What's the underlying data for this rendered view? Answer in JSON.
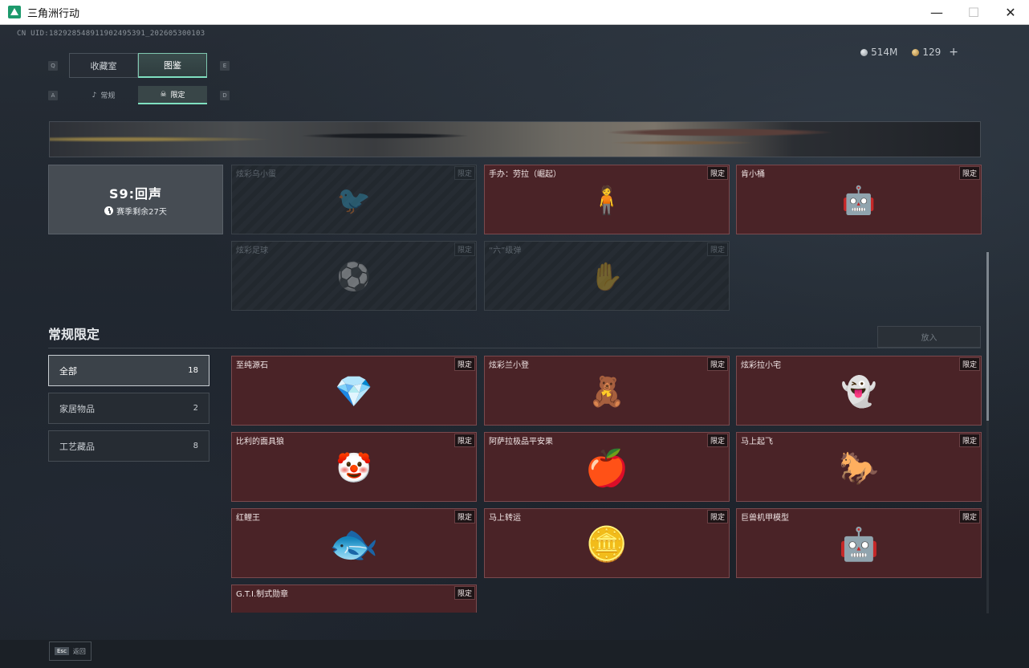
{
  "window": {
    "title": "三角洲行动",
    "minimize_icon": "—",
    "maximize_icon": "☐",
    "close_icon": "✕"
  },
  "header": {
    "uid": "CN UID:1829285489119024953​91_202605300103",
    "currency_silver": "514M",
    "currency_gold": "129",
    "add_label": "+"
  },
  "key_hints": {
    "left_main": "Q",
    "right_main": "E",
    "left_sub": "A",
    "right_sub": "D"
  },
  "main_tabs": [
    {
      "label": "收藏室"
    },
    {
      "label": "图鉴"
    }
  ],
  "sub_tabs": [
    {
      "label": "常规",
      "icon": "♪"
    },
    {
      "label": "限定",
      "icon": "☠"
    }
  ],
  "season": {
    "title": "S9:回声",
    "remaining": "赛季剩余27天"
  },
  "season_items": [
    {
      "name": "炫彩乌小蛋",
      "tag": "限定",
      "art": "🐦",
      "locked": true
    },
    {
      "name": "手办：劳拉（崛起）",
      "tag": "限定",
      "art": "🧍",
      "locked": false
    },
    {
      "name": "肯小桶",
      "tag": "限定",
      "art": "🤖",
      "locked": false
    },
    {
      "name": "炫彩足球",
      "tag": "限定",
      "art": "⚽",
      "locked": true
    },
    {
      "name": "“六”级弹",
      "tag": "限定",
      "art": "✋",
      "locked": true
    }
  ],
  "regular": {
    "section_title": "常规限定",
    "put_in_label": "放入",
    "filters": [
      {
        "label": "全部",
        "count": "18"
      },
      {
        "label": "家居物品",
        "count": "2"
      },
      {
        "label": "工艺藏品",
        "count": "8"
      }
    ],
    "items": [
      {
        "name": "至纯源石",
        "tag": "限定",
        "art": "💎"
      },
      {
        "name": "炫彩兰小登",
        "tag": "限定",
        "art": "🧸"
      },
      {
        "name": "炫彩拉小宅",
        "tag": "限定",
        "art": "👻"
      },
      {
        "name": "比利的面具狼",
        "tag": "限定",
        "art": "🤡"
      },
      {
        "name": "阿萨拉极品平安果",
        "tag": "限定",
        "art": "🍎"
      },
      {
        "name": "马上起飞",
        "tag": "限定",
        "art": "🐎"
      },
      {
        "name": "红鲤王",
        "tag": "限定",
        "art": "🐟"
      },
      {
        "name": "马上转运",
        "tag": "限定",
        "art": "🪙"
      },
      {
        "name": "巨兽机甲模型",
        "tag": "限定",
        "art": "🤖"
      },
      {
        "name": "G.T.I.制式勋章",
        "tag": "限定",
        "art": "🏅"
      }
    ]
  },
  "footer": {
    "esc_key": "Esc",
    "back_label": "返回"
  }
}
